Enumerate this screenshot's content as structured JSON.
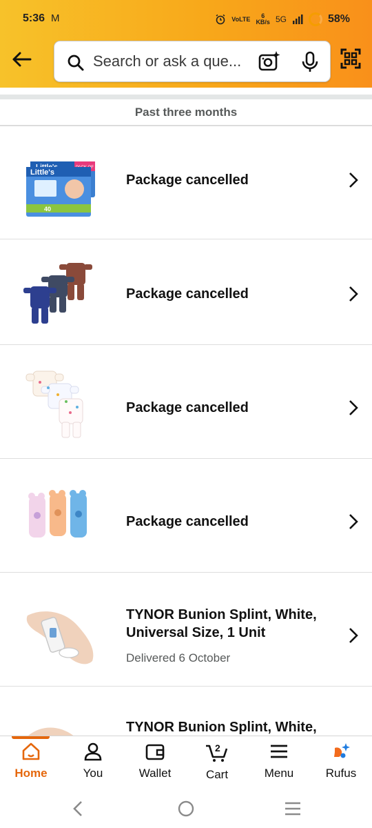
{
  "status_bar": {
    "time": "5:36",
    "mail_icon": "M",
    "network_small_1": "VoLTE",
    "speed_value": "6",
    "speed_unit": "KB/s",
    "network_type": "5G",
    "battery": "58%"
  },
  "search": {
    "placeholder": "Search or ask a que..."
  },
  "section": {
    "title": "Past three months"
  },
  "orders": [
    {
      "title": "Package cancelled",
      "subtitle": ""
    },
    {
      "title": "Package cancelled",
      "subtitle": ""
    },
    {
      "title": "Package cancelled",
      "subtitle": ""
    },
    {
      "title": "Package cancelled",
      "subtitle": ""
    },
    {
      "title": "TYNOR Bunion Splint, White, Universal Size, 1 Unit",
      "subtitle": "Delivered 6 October"
    },
    {
      "title": "TYNOR Bunion Splint, White,",
      "subtitle": ""
    }
  ],
  "thumb_text": {
    "brand": "Little's",
    "pack": "PACK OF 2",
    "count": "40"
  },
  "cart_count": "2",
  "bottom_nav": [
    {
      "label": "Home",
      "icon": "home-icon",
      "active": true
    },
    {
      "label": "You",
      "icon": "person-icon",
      "active": false
    },
    {
      "label": "Wallet",
      "icon": "wallet-icon",
      "active": false
    },
    {
      "label": "Cart",
      "icon": "cart-icon",
      "active": false
    },
    {
      "label": "Menu",
      "icon": "menu-icon",
      "active": false
    },
    {
      "label": "Rufus",
      "icon": "rufus-icon",
      "active": false
    }
  ],
  "colors": {
    "header_start": "#f7c22a",
    "header_end": "#f9901a",
    "accent": "#e5670c",
    "rufus_orange": "#f26b1d",
    "rufus_blue": "#1f7ce0"
  }
}
